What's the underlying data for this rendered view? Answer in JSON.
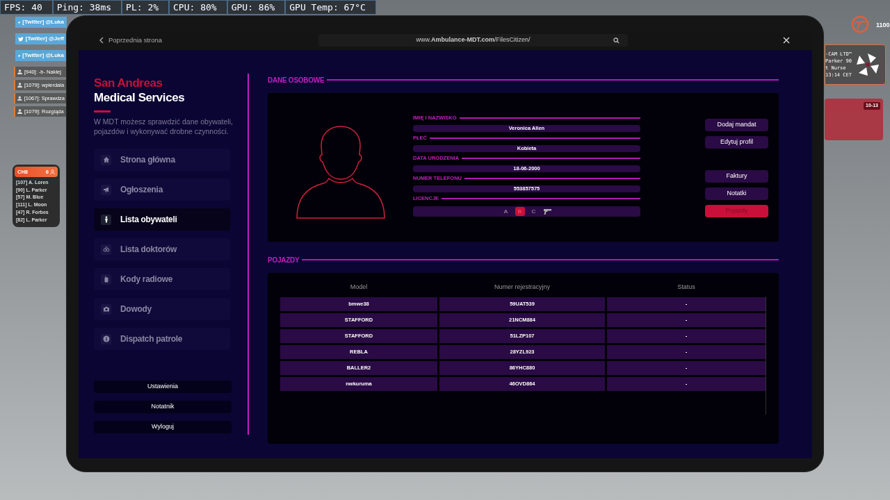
{
  "hud_stats": [
    "FPS: 40",
    "Ping: 38ms",
    "PL: 2%",
    "CPU: 80%",
    "GPU: 86%",
    "GPU Temp: 67°C"
  ],
  "notifications": [
    "[Twitter] @Luka",
    "[Twitter] @Jeff",
    "[Twitter] @Luka"
  ],
  "chat_feed": [
    "[940]: -b- Naklej",
    "[1079]: wpierdala",
    "[1067]: Sprawdza",
    "[1079]: Rozgląda"
  ],
  "radio": {
    "channel": "CH8",
    "count": "6",
    "members": [
      "[107] A. Loren",
      "[90] L. Parker",
      "[57] M. Blue",
      "[111] L. Moon",
      "[47] R. Forbes",
      "[82] L. Parker"
    ]
  },
  "right_hud": {
    "score": "1100",
    "bodycam": [
      "-CAM LTD™",
      "Parker 90",
      "t Nurse",
      "13:14 CET"
    ],
    "code_badge": "10-13"
  },
  "browser": {
    "back_label": "Poprzednia strona",
    "url": "www.**Ambulance-MDT.com**/FilesCitizen/"
  },
  "sidebar": {
    "brand_top": "San Andreas",
    "brand": "Medical Services",
    "description": "W MDT możesz sprawdzić dane obywateli, pojazdów i wykonywać drobne czynności.",
    "items": [
      {
        "kind": "home",
        "label": "Strona główna",
        "selected": false
      },
      {
        "kind": "megaphone",
        "label": "Ogłoszenia",
        "selected": false
      },
      {
        "kind": "person",
        "label": "Lista obywateli",
        "selected": true
      },
      {
        "kind": "glasses",
        "label": "Lista doktorów",
        "selected": false
      },
      {
        "kind": "radio",
        "label": "Kody radiowe",
        "selected": false
      },
      {
        "kind": "camera",
        "label": "Dowody",
        "selected": false
      },
      {
        "kind": "info",
        "label": "Dispatch patrole",
        "selected": false
      }
    ],
    "footer_buttons": [
      "Ustawienia",
      "Notatnik",
      "Wyloguj"
    ]
  },
  "profile": {
    "title": "DANE OSOBOWE",
    "fields": [
      {
        "label": "IMIĘ I NAZWISKO",
        "value": "Veronica Allen"
      },
      {
        "label": "PŁEĆ",
        "value": "Kobieta"
      },
      {
        "label": "DATA URODZENIA",
        "value": "18-06-2000"
      },
      {
        "label": "NUMER TELEFONU",
        "value": "553857575"
      }
    ],
    "licences_label": "LICENCJE",
    "licences": [
      {
        "kind": "letter",
        "text": "A",
        "selected": false
      },
      {
        "kind": "letter",
        "text": "B",
        "selected": true
      },
      {
        "kind": "letter",
        "text": "C",
        "selected": false
      },
      {
        "kind": "weapon",
        "selected": false
      }
    ],
    "actions": [
      {
        "label": "Dodaj mandat",
        "selected": false
      },
      {
        "label": "Edytuj profil",
        "selected": false
      },
      {
        "label": "Faktury",
        "selected": false
      },
      {
        "label": "Notatki",
        "selected": false
      },
      {
        "label": "Pojazdy",
        "selected": true
      }
    ]
  },
  "vehicles": {
    "title": "POJAZDY",
    "columns": [
      "Model",
      "Numer rejestracyjny",
      "Status"
    ],
    "rows": [
      [
        "bmwe38",
        "59UAT539",
        "-"
      ],
      [
        "STAFFORD",
        "21NCM884",
        "-"
      ],
      [
        "STAFFORD",
        "51LZP107",
        "-"
      ],
      [
        "REBLA",
        "28YZL923",
        "-"
      ],
      [
        "BALLER2",
        "86YHC880",
        "-"
      ],
      [
        "nwkuruma",
        "46OVD864",
        "-"
      ]
    ]
  }
}
